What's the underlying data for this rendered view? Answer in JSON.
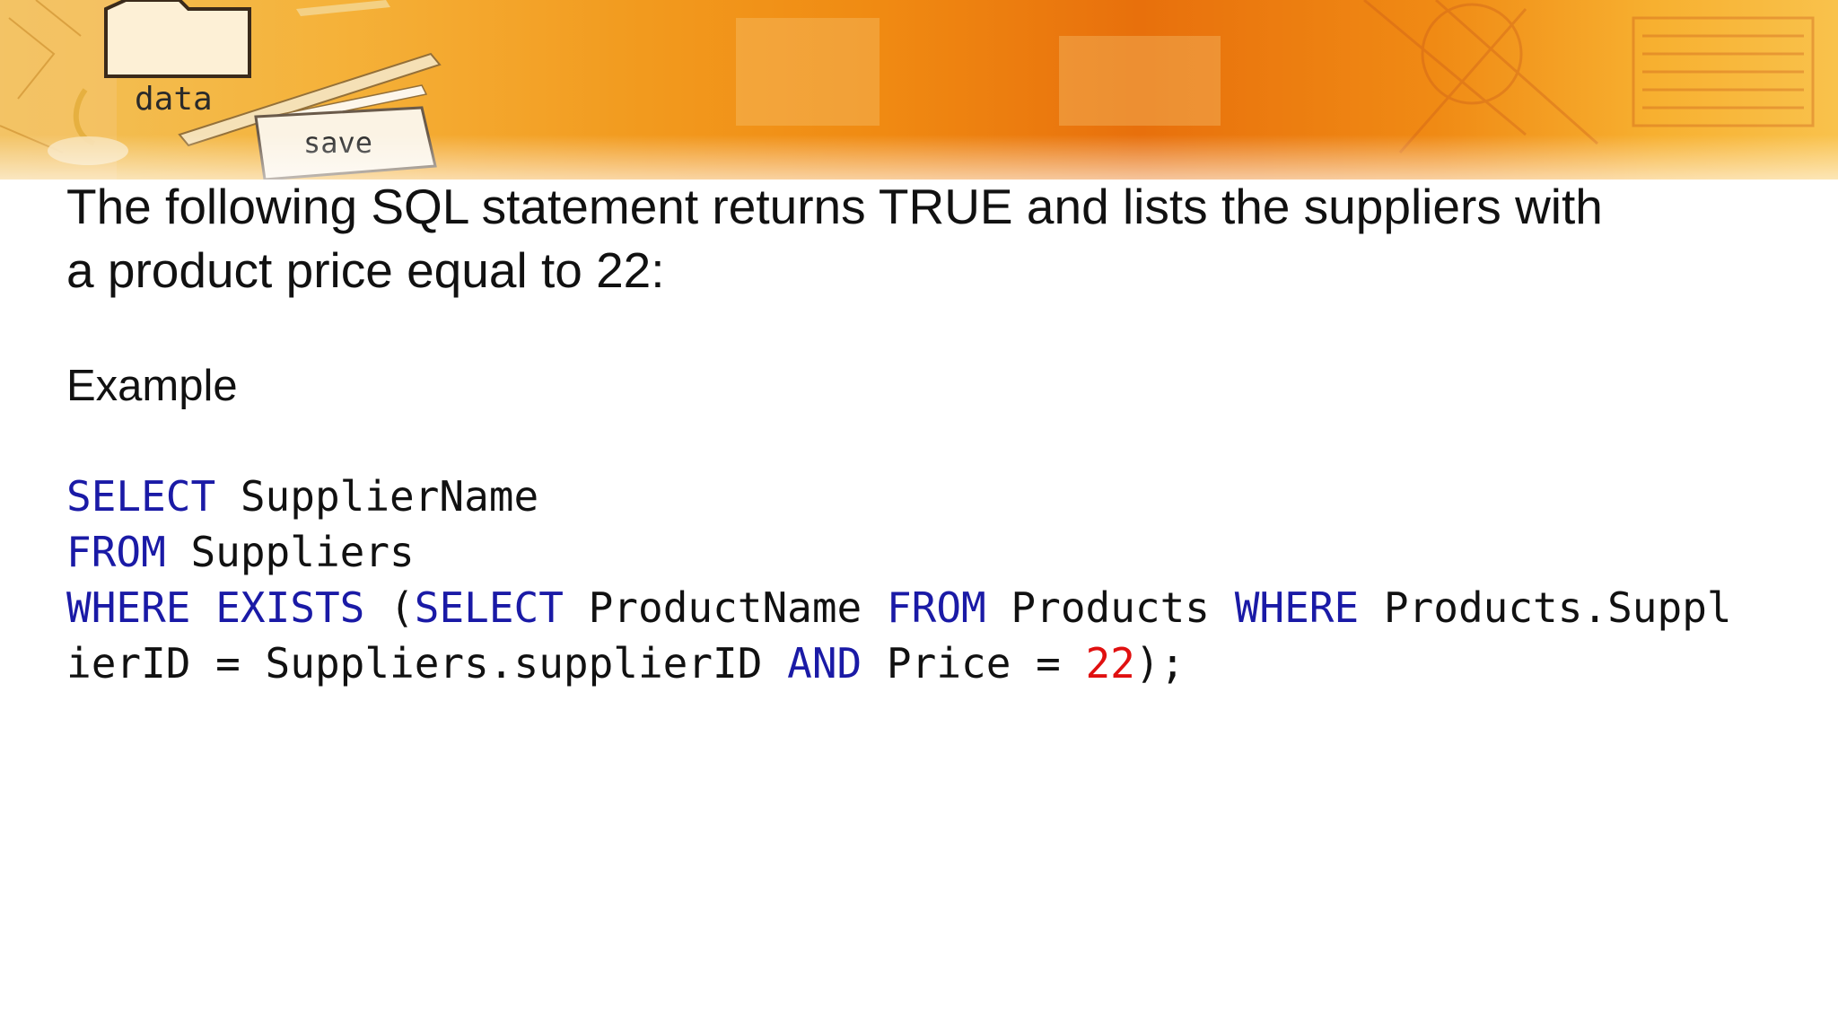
{
  "banner": {
    "label_data": "data",
    "label_save": "save"
  },
  "slide": {
    "heading_line1": "The following SQL statement returns TRUE and lists the suppliers with",
    "heading_line2": "a product price equal to 22:",
    "example_label": "Example"
  },
  "code": {
    "line1": {
      "kw1": "SELECT",
      "t1": " SupplierName"
    },
    "line2": {
      "kw1": "FROM",
      "t1": " Suppliers"
    },
    "line3": {
      "kw1": "WHERE",
      "t1": " ",
      "kw2": "EXISTS",
      "t2": " (",
      "kw3": "SELECT",
      "t3": " ProductName ",
      "kw4": "FROM",
      "t4": " Products ",
      "kw5": "WHERE",
      "t5": " Products.Suppl"
    },
    "line4": {
      "t1": "ierID = Suppliers.supplierID ",
      "kw1": "AND",
      "t2": " Price = ",
      "num": "22",
      "t3": ");"
    }
  },
  "colors": {
    "keyword": "#1a1aa6",
    "number": "#e01010",
    "text": "#111111",
    "banner_orange": "#f08a12"
  }
}
